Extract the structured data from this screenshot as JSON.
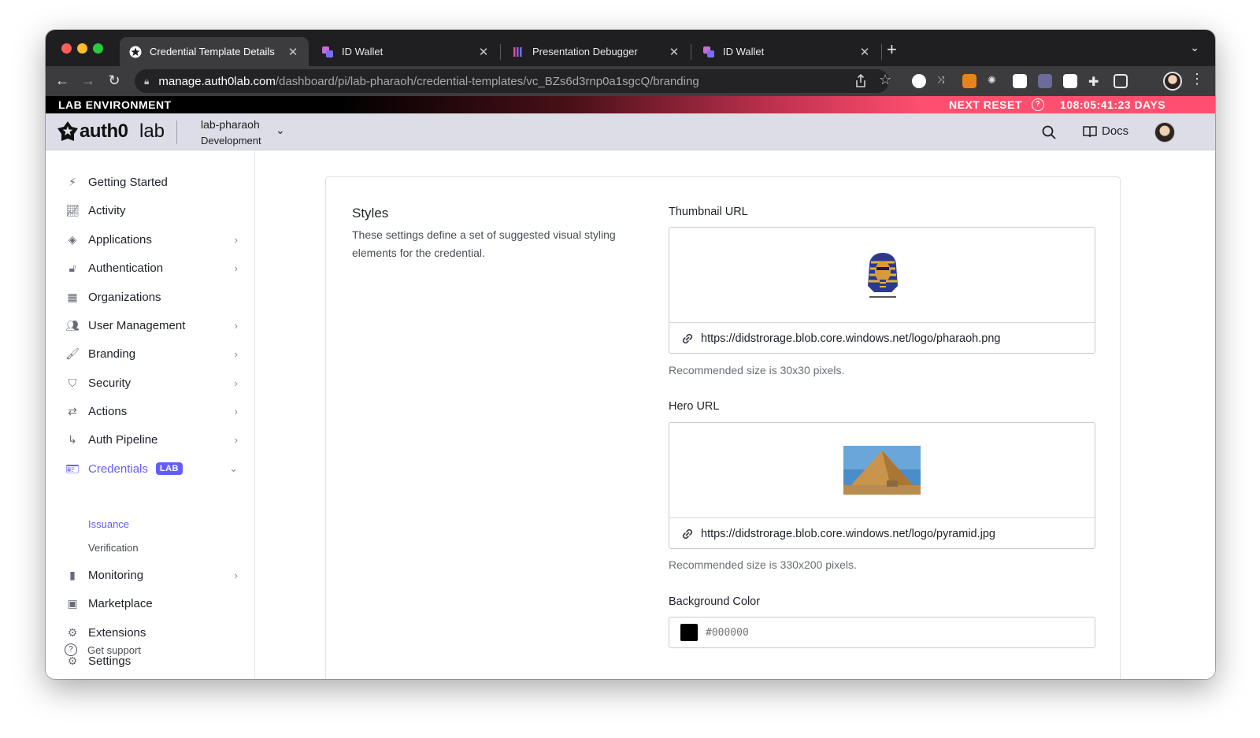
{
  "browser": {
    "tabs": [
      {
        "title": "Credential Template Details",
        "active": true
      },
      {
        "title": "ID Wallet",
        "active": false
      },
      {
        "title": "Presentation Debugger",
        "active": false
      },
      {
        "title": "ID Wallet",
        "active": false
      }
    ],
    "url_host": "manage.auth0lab.com",
    "url_path": "/dashboard/pi/lab-pharaoh/credential-templates/vc_BZs6d3rnp0a1sgcQ/branding"
  },
  "lab_banner": {
    "environment": "LAB ENVIRONMENT",
    "next_reset_label": "NEXT RESET",
    "countdown": "108:05:41:23 DAYS"
  },
  "header": {
    "logo_name": "auth0",
    "logo_suffix": "lab",
    "tenant_name": "lab-pharaoh",
    "tenant_env": "Development",
    "docs_label": "Docs"
  },
  "sidebar": {
    "items": [
      {
        "label": "Getting Started"
      },
      {
        "label": "Activity"
      },
      {
        "label": "Applications"
      },
      {
        "label": "Authentication"
      },
      {
        "label": "Organizations"
      },
      {
        "label": "User Management"
      },
      {
        "label": "Branding"
      },
      {
        "label": "Security"
      },
      {
        "label": "Actions"
      },
      {
        "label": "Auth Pipeline"
      },
      {
        "label": "Credentials",
        "badge": "LAB"
      },
      {
        "label": "Monitoring"
      },
      {
        "label": "Marketplace"
      },
      {
        "label": "Extensions"
      },
      {
        "label": "Settings"
      }
    ],
    "credentials_sub": [
      "Issuance",
      "Verification"
    ],
    "support_label": "Get support"
  },
  "styles_section": {
    "title": "Styles",
    "description": "These settings define a set of suggested visual styling elements for the credential.",
    "thumbnail": {
      "label": "Thumbnail URL",
      "url": "https://didstrorage.blob.core.windows.net/logo/pharaoh.png",
      "hint": "Recommended size is 30x30 pixels."
    },
    "hero": {
      "label": "Hero URL",
      "url": "https://didstrorage.blob.core.windows.net/logo/pyramid.jpg",
      "hint": "Recommended size is 330x200 pixels."
    },
    "background_color": {
      "label": "Background Color",
      "placeholder": "#000000",
      "swatch": "#000000"
    }
  },
  "colors": {
    "accent": "#635dff",
    "tab_bar": "#1f1f21",
    "toolbar": "#3c3c3e",
    "header_bg": "#dcdde7"
  }
}
